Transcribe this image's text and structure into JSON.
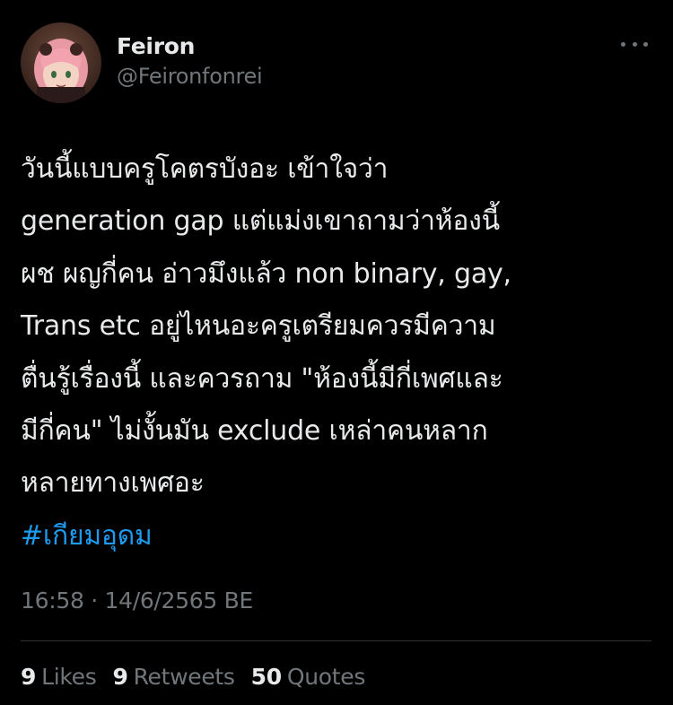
{
  "tweet": {
    "author": {
      "display_name": "Feiron",
      "handle": "@Feironfonrei"
    },
    "lines": [
      "วันนี้แบบครูโคตรบังอะ เข้าใจว่า",
      "generation gap แต่แม่งเขาถามว่าห้องนี้",
      "ผช ผญกี่คน อ่าวมึงแล้ว non binary, gay,",
      "Trans etc อยู่ไหนอะครูเตรียมควรมีความ",
      "ตื่นรู้เรื่องนี้ และควรถาม \"ห้องนี้มีกี่เพศและ",
      "มีกี่คน\" ไม่งั้นมัน exclude เหล่าคนหลาก",
      "หลายทางเพศอะ"
    ],
    "hashtag": "#เกียมอุดม",
    "timestamp": "16:58 · 14/6/2565 BE",
    "stats": {
      "likes_count": "9",
      "likes_label": "Likes",
      "retweets_count": "9",
      "retweets_label": "Retweets",
      "quotes_count": "50",
      "quotes_label": "Quotes"
    }
  },
  "icons": {
    "more": "more-horizontal-icon"
  },
  "colors": {
    "background": "#000000",
    "text_primary": "#e7e9ea",
    "text_secondary": "#71767b",
    "accent": "#1d9bf0",
    "divider": "#2f3336"
  }
}
